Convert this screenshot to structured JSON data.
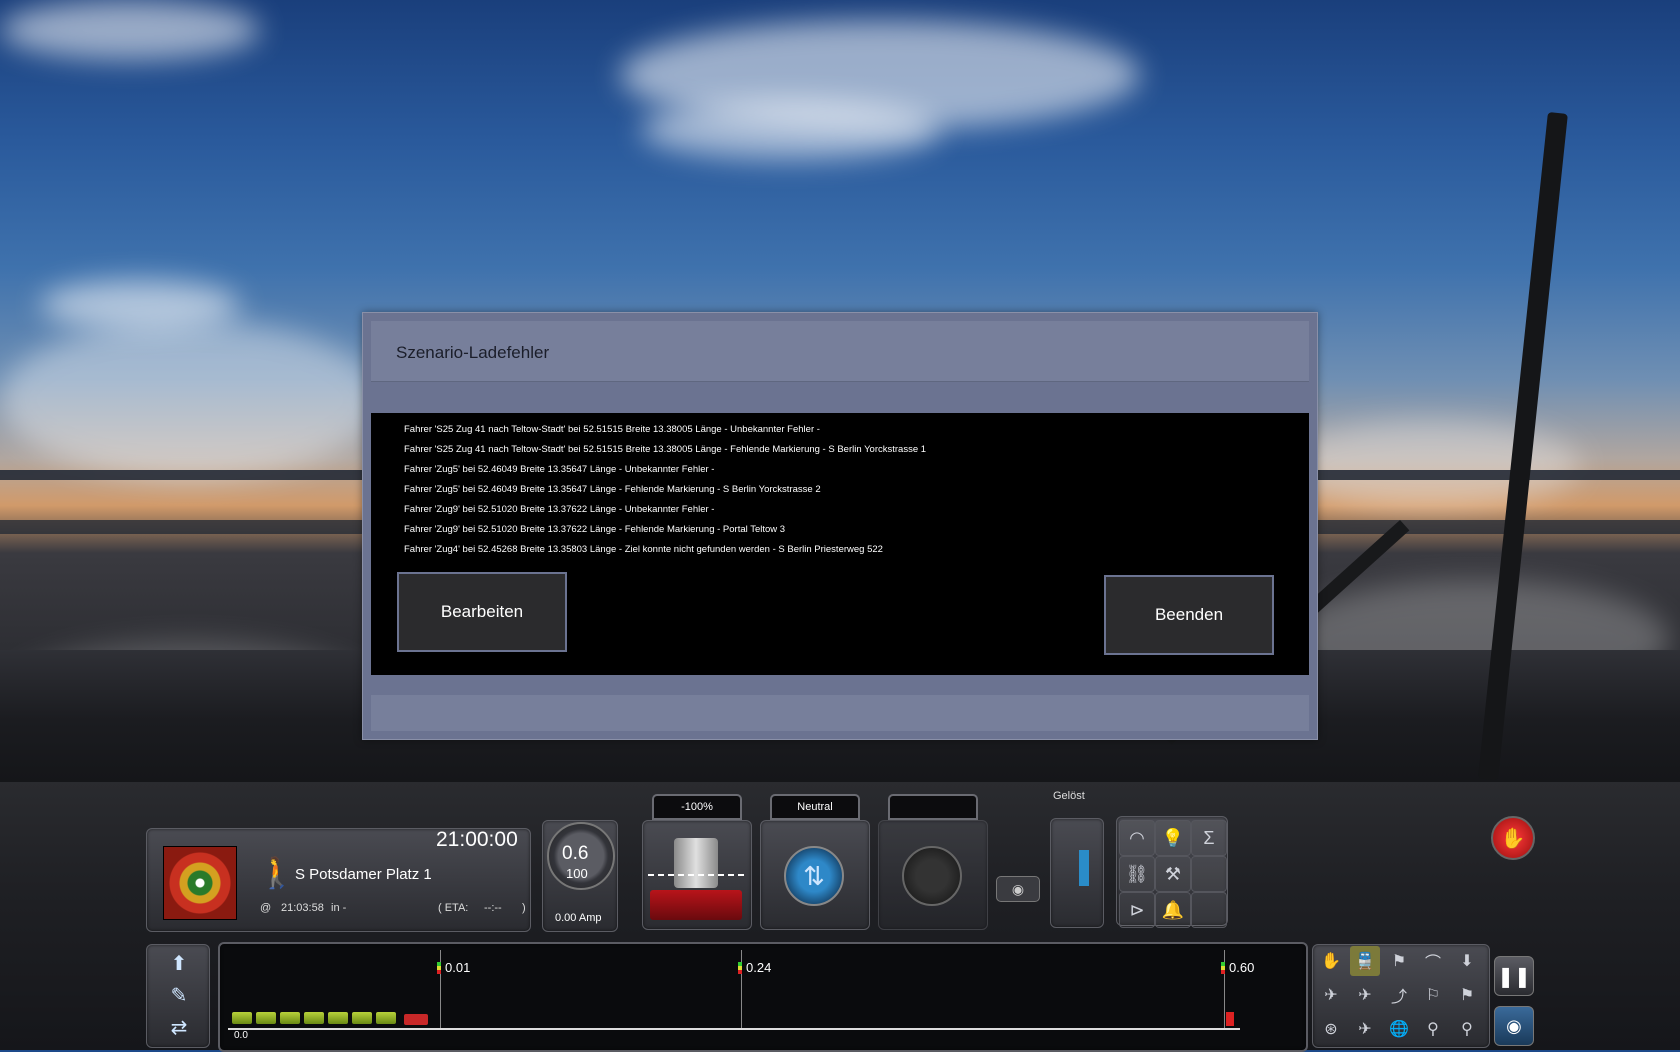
{
  "dialog": {
    "title": "Szenario-Ladefehler",
    "errors": [
      "Fahrer 'S25 Zug 41 nach Teltow-Stadt' bei 52.51515 Breite 13.38005 Länge - Unbekannter Fehler -",
      "Fahrer 'S25 Zug 41 nach Teltow-Stadt' bei 52.51515 Breite 13.38005 Länge - Fehlende Markierung - S Berlin Yorckstrasse 1",
      "Fahrer 'Zug5' bei 52.46049 Breite 13.35647 Länge - Unbekannter Fehler -",
      "Fahrer 'Zug5' bei 52.46049 Breite 13.35647 Länge - Fehlende Markierung - S Berlin Yorckstrasse 2",
      "Fahrer 'Zug9' bei 52.51020 Breite 13.37622 Länge - Unbekannter Fehler -",
      "Fahrer 'Zug9' bei 52.51020 Breite 13.37622 Länge - Fehlende Markierung - Portal Teltow 3",
      "Fahrer 'Zug4' bei 52.45268 Breite 13.35803 Länge - Ziel konnte nicht gefunden werden - S Berlin Priesterweg 522"
    ],
    "edit_label": "Bearbeiten",
    "quit_label": "Beenden"
  },
  "hud": {
    "clock": "21:00:00",
    "destination": "S Potsdamer Platz 1",
    "at_symbol": "@",
    "departure_time": "21:03:58",
    "departure_in": "in -",
    "eta_label": "( ETA:",
    "eta_value": "--:--",
    "eta_close": ")",
    "amp_reading_1": "0.6",
    "amp_reading_2": "100",
    "amp_value": "0.00 Amp",
    "throttle_label": "-100%",
    "reverser_label": "Neutral",
    "brake_status": "Gelöst",
    "track_markers": [
      "0.01",
      "0.24",
      "0.60"
    ],
    "track_start": "0.0"
  },
  "colors": {
    "dialog_frame": "#6b7391",
    "dialog_body": "#000000",
    "button_bg": "#2b2b2d",
    "stop_red": "#d01818",
    "reverser_blue": "#2e88c8"
  },
  "icons": {
    "walk": "pedestrian-icon",
    "stop": "emergency-stop-icon",
    "pause": "pause-icon",
    "camera": "camera-icon"
  }
}
